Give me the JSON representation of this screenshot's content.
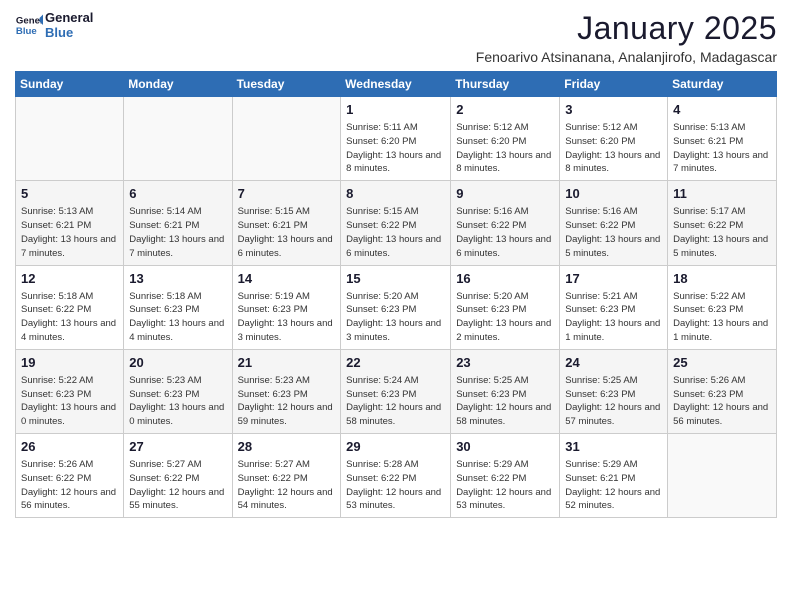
{
  "header": {
    "logo_line1": "General",
    "logo_line2": "Blue",
    "title": "January 2025",
    "subtitle": "Fenoarivo Atsinanana, Analanjirofo, Madagascar"
  },
  "weekdays": [
    "Sunday",
    "Monday",
    "Tuesday",
    "Wednesday",
    "Thursday",
    "Friday",
    "Saturday"
  ],
  "weeks": [
    [
      {
        "day": "",
        "info": ""
      },
      {
        "day": "",
        "info": ""
      },
      {
        "day": "",
        "info": ""
      },
      {
        "day": "1",
        "info": "Sunrise: 5:11 AM\nSunset: 6:20 PM\nDaylight: 13 hours and 8 minutes."
      },
      {
        "day": "2",
        "info": "Sunrise: 5:12 AM\nSunset: 6:20 PM\nDaylight: 13 hours and 8 minutes."
      },
      {
        "day": "3",
        "info": "Sunrise: 5:12 AM\nSunset: 6:20 PM\nDaylight: 13 hours and 8 minutes."
      },
      {
        "day": "4",
        "info": "Sunrise: 5:13 AM\nSunset: 6:21 PM\nDaylight: 13 hours and 7 minutes."
      }
    ],
    [
      {
        "day": "5",
        "info": "Sunrise: 5:13 AM\nSunset: 6:21 PM\nDaylight: 13 hours and 7 minutes."
      },
      {
        "day": "6",
        "info": "Sunrise: 5:14 AM\nSunset: 6:21 PM\nDaylight: 13 hours and 7 minutes."
      },
      {
        "day": "7",
        "info": "Sunrise: 5:15 AM\nSunset: 6:21 PM\nDaylight: 13 hours and 6 minutes."
      },
      {
        "day": "8",
        "info": "Sunrise: 5:15 AM\nSunset: 6:22 PM\nDaylight: 13 hours and 6 minutes."
      },
      {
        "day": "9",
        "info": "Sunrise: 5:16 AM\nSunset: 6:22 PM\nDaylight: 13 hours and 6 minutes."
      },
      {
        "day": "10",
        "info": "Sunrise: 5:16 AM\nSunset: 6:22 PM\nDaylight: 13 hours and 5 minutes."
      },
      {
        "day": "11",
        "info": "Sunrise: 5:17 AM\nSunset: 6:22 PM\nDaylight: 13 hours and 5 minutes."
      }
    ],
    [
      {
        "day": "12",
        "info": "Sunrise: 5:18 AM\nSunset: 6:22 PM\nDaylight: 13 hours and 4 minutes."
      },
      {
        "day": "13",
        "info": "Sunrise: 5:18 AM\nSunset: 6:23 PM\nDaylight: 13 hours and 4 minutes."
      },
      {
        "day": "14",
        "info": "Sunrise: 5:19 AM\nSunset: 6:23 PM\nDaylight: 13 hours and 3 minutes."
      },
      {
        "day": "15",
        "info": "Sunrise: 5:20 AM\nSunset: 6:23 PM\nDaylight: 13 hours and 3 minutes."
      },
      {
        "day": "16",
        "info": "Sunrise: 5:20 AM\nSunset: 6:23 PM\nDaylight: 13 hours and 2 minutes."
      },
      {
        "day": "17",
        "info": "Sunrise: 5:21 AM\nSunset: 6:23 PM\nDaylight: 13 hours and 1 minute."
      },
      {
        "day": "18",
        "info": "Sunrise: 5:22 AM\nSunset: 6:23 PM\nDaylight: 13 hours and 1 minute."
      }
    ],
    [
      {
        "day": "19",
        "info": "Sunrise: 5:22 AM\nSunset: 6:23 PM\nDaylight: 13 hours and 0 minutes."
      },
      {
        "day": "20",
        "info": "Sunrise: 5:23 AM\nSunset: 6:23 PM\nDaylight: 13 hours and 0 minutes."
      },
      {
        "day": "21",
        "info": "Sunrise: 5:23 AM\nSunset: 6:23 PM\nDaylight: 12 hours and 59 minutes."
      },
      {
        "day": "22",
        "info": "Sunrise: 5:24 AM\nSunset: 6:23 PM\nDaylight: 12 hours and 58 minutes."
      },
      {
        "day": "23",
        "info": "Sunrise: 5:25 AM\nSunset: 6:23 PM\nDaylight: 12 hours and 58 minutes."
      },
      {
        "day": "24",
        "info": "Sunrise: 5:25 AM\nSunset: 6:23 PM\nDaylight: 12 hours and 57 minutes."
      },
      {
        "day": "25",
        "info": "Sunrise: 5:26 AM\nSunset: 6:23 PM\nDaylight: 12 hours and 56 minutes."
      }
    ],
    [
      {
        "day": "26",
        "info": "Sunrise: 5:26 AM\nSunset: 6:22 PM\nDaylight: 12 hours and 56 minutes."
      },
      {
        "day": "27",
        "info": "Sunrise: 5:27 AM\nSunset: 6:22 PM\nDaylight: 12 hours and 55 minutes."
      },
      {
        "day": "28",
        "info": "Sunrise: 5:27 AM\nSunset: 6:22 PM\nDaylight: 12 hours and 54 minutes."
      },
      {
        "day": "29",
        "info": "Sunrise: 5:28 AM\nSunset: 6:22 PM\nDaylight: 12 hours and 53 minutes."
      },
      {
        "day": "30",
        "info": "Sunrise: 5:29 AM\nSunset: 6:22 PM\nDaylight: 12 hours and 53 minutes."
      },
      {
        "day": "31",
        "info": "Sunrise: 5:29 AM\nSunset: 6:21 PM\nDaylight: 12 hours and 52 minutes."
      },
      {
        "day": "",
        "info": ""
      }
    ]
  ]
}
